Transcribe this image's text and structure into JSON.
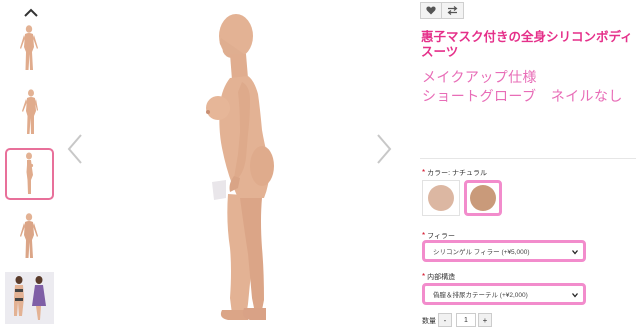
{
  "gallery": {
    "up_icon": "chevron-up-icon",
    "prev_icon": "chevron-left-icon",
    "next_icon": "chevron-right-icon",
    "thumbnails": [
      {
        "name": "front view"
      },
      {
        "name": "three-quarter view"
      },
      {
        "name": "side view",
        "selected": true
      },
      {
        "name": "back view"
      },
      {
        "name": "lingerie photos"
      }
    ]
  },
  "product": {
    "favorite_icon": "heart-icon",
    "compare_icon": "compare-arrows-icon",
    "title": "惠子マスク付きの全身シリコンボディスーツ",
    "subtitle_line1": "メイクアップ仕様",
    "subtitle_line2": "ショートグローブ　ネイルなし"
  },
  "options": {
    "required_mark": "*",
    "color_label": "カラー: ナチュラル",
    "color_swatches": [
      "#dcb7a2",
      "#c99a7a"
    ],
    "filler_label": "フィラー",
    "filler_value": "シリコンゲル フィラー (+¥5,000)",
    "internal_label": "内部構造",
    "internal_value": "偽膣＆排尿カテーテル (+¥2,000)"
  },
  "quantity": {
    "label": "数量",
    "minus": "-",
    "value": "1",
    "plus": "+"
  },
  "colors": {
    "accent_pink": "#e5308a",
    "subtitle_pink": "#e86db7",
    "highlight_border": "#f28ccc",
    "skin": "#e3b294"
  }
}
